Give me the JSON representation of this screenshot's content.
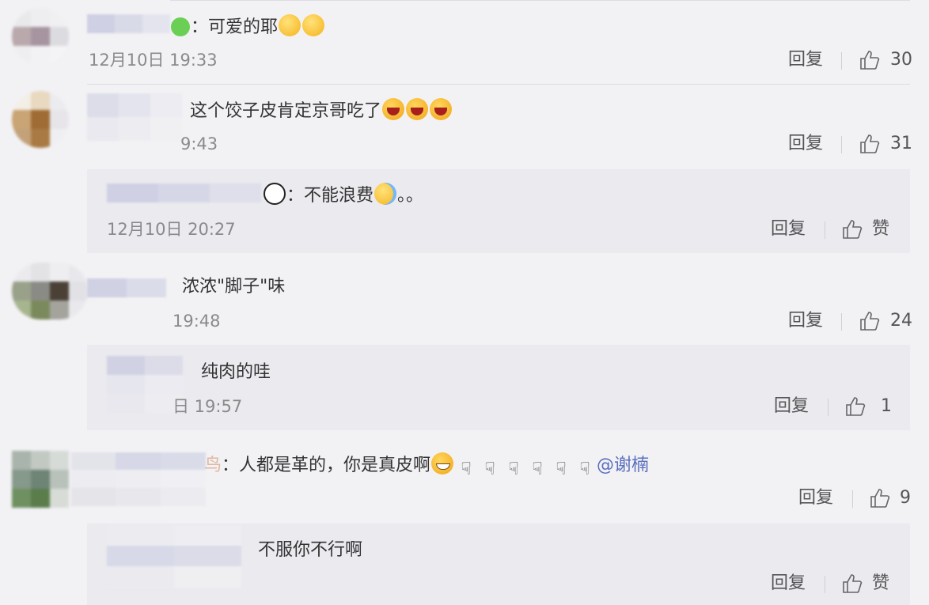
{
  "comments": [
    {
      "id": "c1",
      "text_prefix": "：可爱的耶",
      "time": "12月10日 19:33",
      "reply_label": "回复",
      "like_count": "30"
    },
    {
      "id": "c2",
      "text": "这个饺子皮肯定京哥吃了",
      "time": "9:43",
      "reply_label": "回复",
      "like_count": "31",
      "reply": {
        "text": "：不能浪费",
        "text_suffix": "。。",
        "time": "12月10日 20:27",
        "reply_label": "回复",
        "like_label": "赞"
      }
    },
    {
      "id": "c3",
      "text": "浓浓\"脚子\"味",
      "time": "19:48",
      "reply_label": "回复",
      "like_count": "24",
      "reply": {
        "text": "纯肉的哇",
        "time": "日 19:57",
        "reply_label": "回复",
        "like_count": "1"
      }
    },
    {
      "id": "c4",
      "text_name_tail": "鸟",
      "text": "：人都是革的，你是真皮啊",
      "mention": "@谢楠",
      "reply_label": "回复",
      "like_count": "9",
      "reply": {
        "text": "不服你不行啊",
        "reply_label": "回复",
        "like_label": "赞"
      }
    }
  ],
  "icons": {
    "like": "thumbs-up-icon",
    "emoji_love": "green-heart-icon",
    "emoji_cute": "blushing-face-icon",
    "emoji_laugh": "laughing-face-icon",
    "emoji_cry_laugh": "tears-of-joy-icon",
    "emoji_panda": "panda-icon",
    "emoji_grin": "grinning-face-icon",
    "emoji_hand": "rock-hand-icon"
  },
  "colors": {
    "background": "#f2f2f5",
    "reply_background": "#eaeaef",
    "mention": "#5a6fbf",
    "meta_text": "#8a8a8a"
  }
}
